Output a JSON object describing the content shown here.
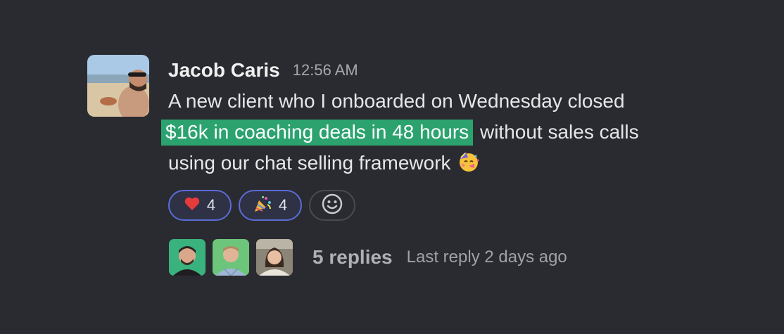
{
  "message": {
    "author": "Jacob Caris",
    "timestamp": "12:56 AM",
    "text_line1": "A new client who I onboarded on Wednesday closed",
    "text_highlight": "$16k in coaching deals in 48 hours",
    "text_after_highlight": " without sales calls",
    "text_line3": "using our chat selling framework ",
    "inline_emoji": "face-with-party-horn-icon"
  },
  "reactions": [
    {
      "emoji": "red-heart-icon",
      "count": "4"
    },
    {
      "emoji": "party-popper-icon",
      "count": "4"
    }
  ],
  "add_reaction_icon": "smiley-add-icon",
  "thread": {
    "replies": "5 replies",
    "last_reply": "Last reply 2 days ago"
  },
  "colors": {
    "background": "#2a2b30",
    "highlight": "#2ca36f",
    "reaction_border": "#5a6cd6"
  }
}
